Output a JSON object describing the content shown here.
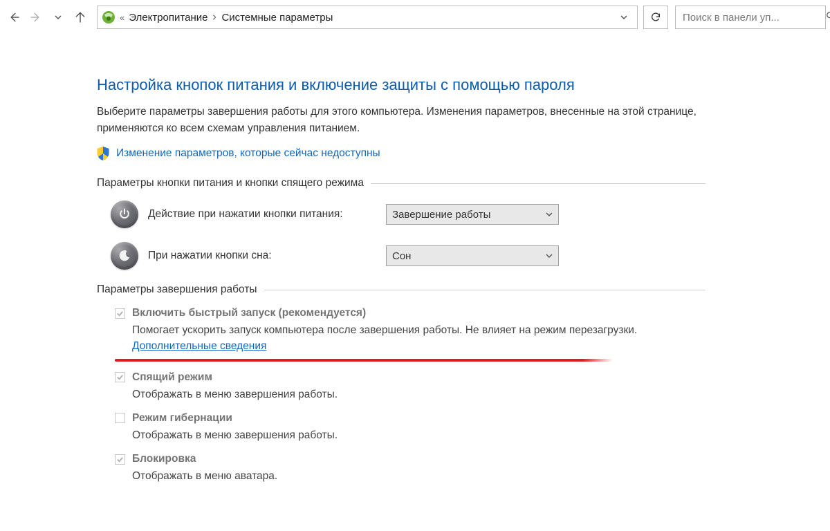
{
  "nav": {
    "breadcrumb_prefix": "«",
    "crumb1": "Электропитание",
    "crumb2": "Системные параметры",
    "search_placeholder": "Поиск в панели уп..."
  },
  "main": {
    "title": "Настройка кнопок питания и включение защиты с помощью пароля",
    "intro": "Выберите параметры завершения работы для этого компьютера. Изменения параметров, внесенные на этой странице, применяются ко всем схемам управления питанием.",
    "shield_link": "Изменение параметров, которые сейчас недоступны",
    "section1_title": "Параметры кнопки питания и кнопки спящего режима",
    "power_button_label": "Действие при нажатии кнопки питания:",
    "power_button_value": "Завершение работы",
    "sleep_button_label": "При нажатии кнопки сна:",
    "sleep_button_value": "Сон",
    "section2_title": "Параметры завершения работы",
    "items": [
      {
        "checked": true,
        "label": "Включить быстрый запуск (рекомендуется)",
        "desc_prefix": "Помогает ускорить запуск компьютера после завершения работы. Не влияет на режим перезагрузки. ",
        "desc_link": "Дополнительные сведения"
      },
      {
        "checked": true,
        "label": "Спящий режим",
        "desc": "Отображать в меню завершения работы."
      },
      {
        "checked": false,
        "label": "Режим гибернации",
        "desc": "Отображать в меню завершения работы."
      },
      {
        "checked": true,
        "label": "Блокировка",
        "desc": "Отображать в меню аватара."
      }
    ]
  }
}
